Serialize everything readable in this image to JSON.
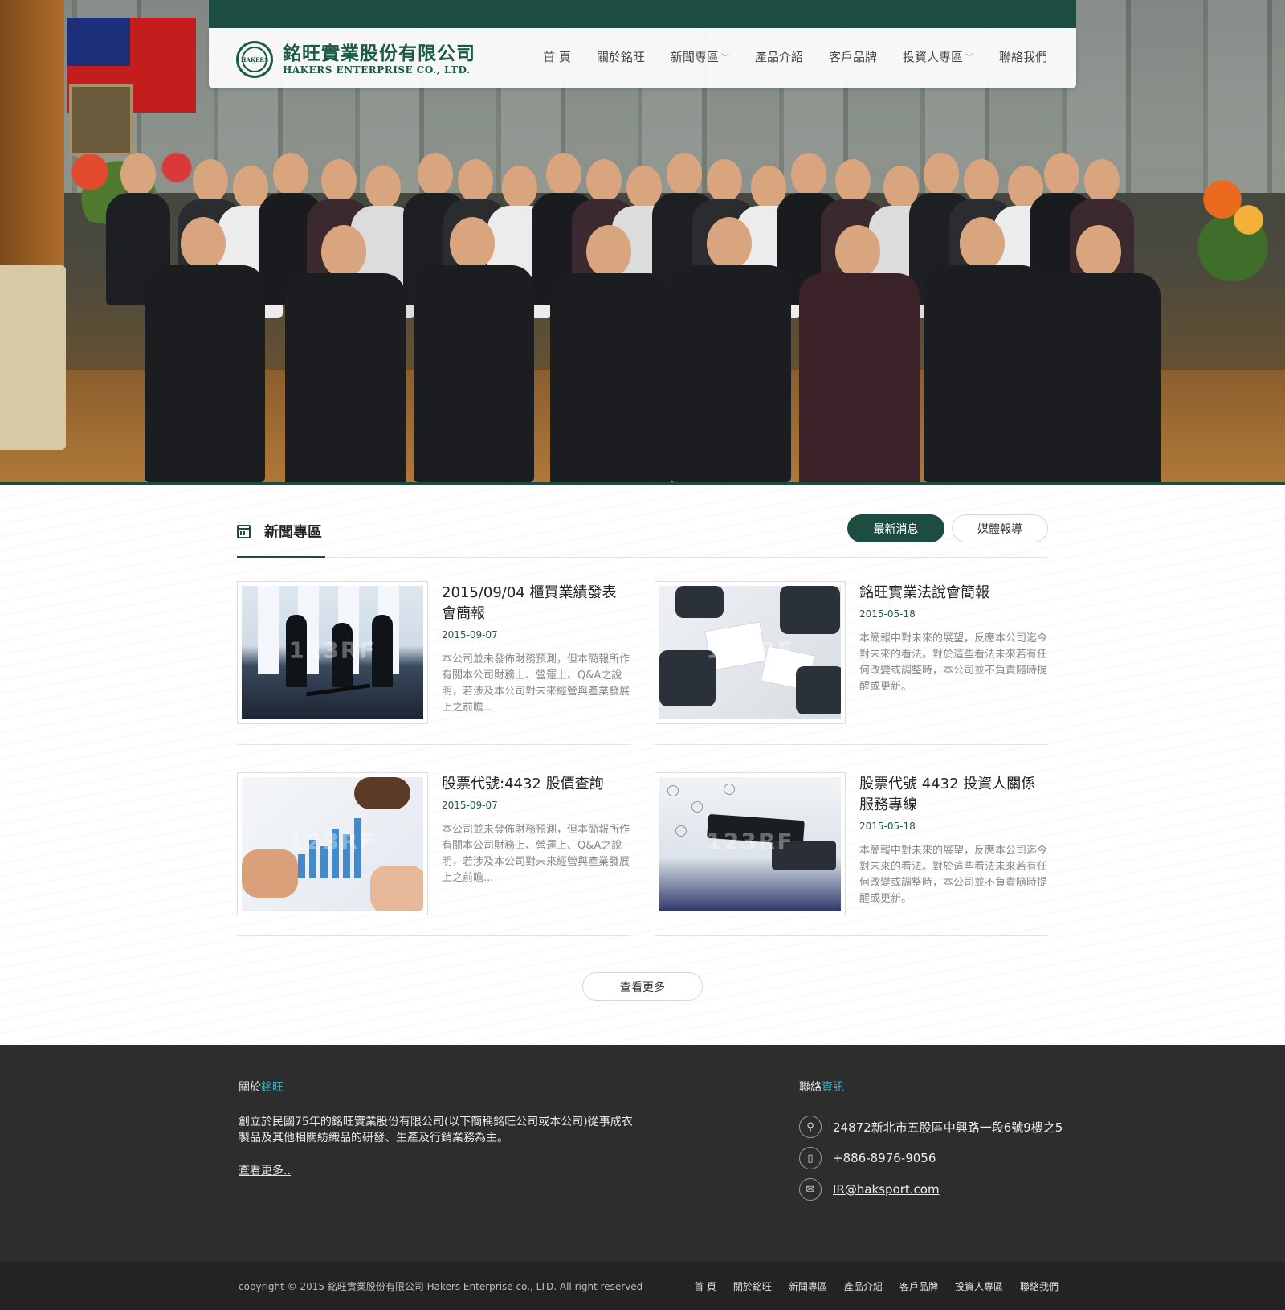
{
  "brand": {
    "name_cn": "銘旺實業股份有限公司",
    "name_en": "HAKERS ENTERPRISE CO., LTD.",
    "logo_mark_text": "HAKERS",
    "primary_color": "#1c4d40",
    "accent_color": "#2fb4c7"
  },
  "nav": {
    "items": [
      {
        "label": "首 頁",
        "has_dropdown": false
      },
      {
        "label": "關於銘旺",
        "has_dropdown": false
      },
      {
        "label": "新聞專區",
        "has_dropdown": true
      },
      {
        "label": "產品介紹",
        "has_dropdown": false
      },
      {
        "label": "客戶品牌",
        "has_dropdown": false
      },
      {
        "label": "投資人專區",
        "has_dropdown": true
      },
      {
        "label": "聯絡我們",
        "has_dropdown": false
      }
    ]
  },
  "news": {
    "section_title": "新聞專區",
    "icon": "calendar-icon",
    "tabs": [
      {
        "label": "最新消息",
        "active": true
      },
      {
        "label": "媒體報導",
        "active": false
      }
    ],
    "items": [
      {
        "title": "2015/09/04 櫃買業績發表會簡報",
        "date": "2015-09-07",
        "excerpt": "本公司並未發佈財務預測，但本簡報所作有關本公司財務上、營運上、Q&A之說明，若涉及本公司對未來經營與產業發展上之前瞻..."
      },
      {
        "title": "銘旺實業法說會簡報",
        "date": "2015-05-18",
        "excerpt": "本簡報中對未來的展望，反應本公司迄今對未來的看法。對於這些看法未來若有任何改變或調整時，本公司並不負責隨時提醒或更新。"
      },
      {
        "title": "股票代號:4432 股價查詢",
        "date": "2015-09-07",
        "excerpt": "本公司並未發佈財務預測，但本簡報所作有關本公司財務上、營運上、Q&A之說明，若涉及本公司對未來經營與產業發展上之前瞻..."
      },
      {
        "title": "股票代號 4432 投資人關係服務專線",
        "date": "2015-05-18",
        "excerpt": "本簡報中對未來的展望，反應本公司迄今對未來的看法。對於這些看法未來若有任何改變或調整時，本公司並不負責隨時提醒或更新。"
      }
    ],
    "thumb_watermark": "123RF",
    "more_label": "查看更多"
  },
  "footer": {
    "about_heading_prefix": "關於",
    "about_heading_accent": "銘旺",
    "about_text": "創立於民國75年的銘旺實業股份有限公司(以下簡稱銘旺公司或本公司)從事成衣製品及其他相關紡織品的研發、生產及行銷業務為主。",
    "about_more": "查看更多",
    "about_more_suffix": "..",
    "contact_heading_prefix": "聯絡",
    "contact_heading_accent": "資訊",
    "address": "24872新北市五股區中興路一段6號9樓之5",
    "phone": "+886-8976-9056",
    "email": "IR@haksport.com",
    "contact_icons": [
      "map-pin-icon",
      "phone-icon",
      "mail-icon"
    ],
    "copyright": "copyright © 2015 銘旺實業股份有限公司 Hakers Enterprise co., LTD. All right reserved",
    "nav": [
      "首 頁",
      "關於銘旺",
      "新聞專區",
      "產品介紹",
      "客戶品牌",
      "投資人專區",
      "聯絡我們"
    ]
  }
}
